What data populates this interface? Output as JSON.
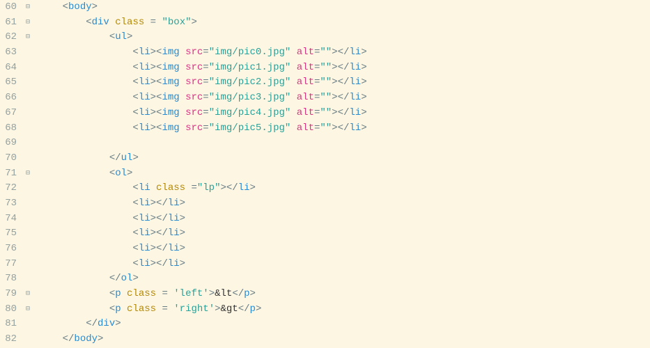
{
  "lines": [
    {
      "num": "60",
      "fold": "⊟",
      "indent": 1,
      "segments": [
        {
          "t": "punct",
          "v": "<"
        },
        {
          "t": "tag",
          "v": "body"
        },
        {
          "t": "punct",
          "v": ">"
        }
      ]
    },
    {
      "num": "61",
      "fold": "⊟",
      "indent": 2,
      "segments": [
        {
          "t": "punct",
          "v": "<"
        },
        {
          "t": "tag",
          "v": "div"
        },
        {
          "t": "text",
          "v": " "
        },
        {
          "t": "attr-name",
          "v": "class"
        },
        {
          "t": "text",
          "v": " "
        },
        {
          "t": "punct",
          "v": "="
        },
        {
          "t": "text",
          "v": " "
        },
        {
          "t": "string",
          "v": "\"box\""
        },
        {
          "t": "punct",
          "v": ">"
        }
      ]
    },
    {
      "num": "62",
      "fold": "⊟",
      "indent": 3,
      "segments": [
        {
          "t": "punct",
          "v": "<"
        },
        {
          "t": "tag",
          "v": "ul"
        },
        {
          "t": "punct",
          "v": ">"
        }
      ]
    },
    {
      "num": "63",
      "fold": "",
      "indent": 4,
      "segments": [
        {
          "t": "punct",
          "v": "<"
        },
        {
          "t": "tag",
          "v": "li"
        },
        {
          "t": "punct",
          "v": "><"
        },
        {
          "t": "tag",
          "v": "img"
        },
        {
          "t": "text",
          "v": " "
        },
        {
          "t": "attr-key",
          "v": "src"
        },
        {
          "t": "punct",
          "v": "="
        },
        {
          "t": "string",
          "v": "\"img/pic0.jpg\""
        },
        {
          "t": "text",
          "v": " "
        },
        {
          "t": "attr-key",
          "v": "alt"
        },
        {
          "t": "punct",
          "v": "="
        },
        {
          "t": "string",
          "v": "\"\""
        },
        {
          "t": "punct",
          "v": "></"
        },
        {
          "t": "tag",
          "v": "li"
        },
        {
          "t": "punct",
          "v": ">"
        }
      ]
    },
    {
      "num": "64",
      "fold": "",
      "indent": 4,
      "segments": [
        {
          "t": "punct",
          "v": "<"
        },
        {
          "t": "tag",
          "v": "li"
        },
        {
          "t": "punct",
          "v": "><"
        },
        {
          "t": "tag",
          "v": "img"
        },
        {
          "t": "text",
          "v": " "
        },
        {
          "t": "attr-key",
          "v": "src"
        },
        {
          "t": "punct",
          "v": "="
        },
        {
          "t": "string",
          "v": "\"img/pic1.jpg\""
        },
        {
          "t": "text",
          "v": " "
        },
        {
          "t": "attr-key",
          "v": "alt"
        },
        {
          "t": "punct",
          "v": "="
        },
        {
          "t": "string",
          "v": "\"\""
        },
        {
          "t": "punct",
          "v": "></"
        },
        {
          "t": "tag",
          "v": "li"
        },
        {
          "t": "punct",
          "v": ">"
        }
      ]
    },
    {
      "num": "65",
      "fold": "",
      "indent": 4,
      "segments": [
        {
          "t": "punct",
          "v": "<"
        },
        {
          "t": "tag",
          "v": "li"
        },
        {
          "t": "punct",
          "v": "><"
        },
        {
          "t": "tag",
          "v": "img"
        },
        {
          "t": "text",
          "v": " "
        },
        {
          "t": "attr-key",
          "v": "src"
        },
        {
          "t": "punct",
          "v": "="
        },
        {
          "t": "string",
          "v": "\"img/pic2.jpg\""
        },
        {
          "t": "text",
          "v": " "
        },
        {
          "t": "attr-key",
          "v": "alt"
        },
        {
          "t": "punct",
          "v": "="
        },
        {
          "t": "string",
          "v": "\"\""
        },
        {
          "t": "punct",
          "v": "></"
        },
        {
          "t": "tag",
          "v": "li"
        },
        {
          "t": "punct",
          "v": ">"
        }
      ]
    },
    {
      "num": "66",
      "fold": "",
      "indent": 4,
      "segments": [
        {
          "t": "punct",
          "v": "<"
        },
        {
          "t": "tag",
          "v": "li"
        },
        {
          "t": "punct",
          "v": "><"
        },
        {
          "t": "tag",
          "v": "img"
        },
        {
          "t": "text",
          "v": " "
        },
        {
          "t": "attr-key",
          "v": "src"
        },
        {
          "t": "punct",
          "v": "="
        },
        {
          "t": "string",
          "v": "\"img/pic3.jpg\""
        },
        {
          "t": "text",
          "v": " "
        },
        {
          "t": "attr-key",
          "v": "alt"
        },
        {
          "t": "punct",
          "v": "="
        },
        {
          "t": "string",
          "v": "\"\""
        },
        {
          "t": "punct",
          "v": "></"
        },
        {
          "t": "tag",
          "v": "li"
        },
        {
          "t": "punct",
          "v": ">"
        }
      ]
    },
    {
      "num": "67",
      "fold": "",
      "indent": 4,
      "segments": [
        {
          "t": "punct",
          "v": "<"
        },
        {
          "t": "tag",
          "v": "li"
        },
        {
          "t": "punct",
          "v": "><"
        },
        {
          "t": "tag",
          "v": "img"
        },
        {
          "t": "text",
          "v": " "
        },
        {
          "t": "attr-key",
          "v": "src"
        },
        {
          "t": "punct",
          "v": "="
        },
        {
          "t": "string",
          "v": "\"img/pic4.jpg\""
        },
        {
          "t": "text",
          "v": " "
        },
        {
          "t": "attr-key",
          "v": "alt"
        },
        {
          "t": "punct",
          "v": "="
        },
        {
          "t": "string",
          "v": "\"\""
        },
        {
          "t": "punct",
          "v": "></"
        },
        {
          "t": "tag",
          "v": "li"
        },
        {
          "t": "punct",
          "v": ">"
        }
      ]
    },
    {
      "num": "68",
      "fold": "",
      "indent": 4,
      "segments": [
        {
          "t": "punct",
          "v": "<"
        },
        {
          "t": "tag",
          "v": "li"
        },
        {
          "t": "punct",
          "v": "><"
        },
        {
          "t": "tag",
          "v": "img"
        },
        {
          "t": "text",
          "v": " "
        },
        {
          "t": "attr-key",
          "v": "src"
        },
        {
          "t": "punct",
          "v": "="
        },
        {
          "t": "string",
          "v": "\"img/pic5.jpg\""
        },
        {
          "t": "text",
          "v": " "
        },
        {
          "t": "attr-key",
          "v": "alt"
        },
        {
          "t": "punct",
          "v": "="
        },
        {
          "t": "string",
          "v": "\"\""
        },
        {
          "t": "punct",
          "v": "></"
        },
        {
          "t": "tag",
          "v": "li"
        },
        {
          "t": "punct",
          "v": ">"
        }
      ]
    },
    {
      "num": "69",
      "fold": "",
      "indent": 0,
      "segments": []
    },
    {
      "num": "70",
      "fold": "",
      "indent": 3,
      "segments": [
        {
          "t": "punct",
          "v": "</"
        },
        {
          "t": "tag",
          "v": "ul"
        },
        {
          "t": "punct",
          "v": ">"
        }
      ]
    },
    {
      "num": "71",
      "fold": "⊟",
      "indent": 3,
      "segments": [
        {
          "t": "punct",
          "v": "<"
        },
        {
          "t": "tag",
          "v": "ol"
        },
        {
          "t": "punct",
          "v": ">"
        }
      ]
    },
    {
      "num": "72",
      "fold": "",
      "indent": 4,
      "segments": [
        {
          "t": "punct",
          "v": "<"
        },
        {
          "t": "tag",
          "v": "li"
        },
        {
          "t": "text",
          "v": " "
        },
        {
          "t": "attr-name",
          "v": "class"
        },
        {
          "t": "text",
          "v": " "
        },
        {
          "t": "punct",
          "v": "="
        },
        {
          "t": "string",
          "v": "\"lp\""
        },
        {
          "t": "punct",
          "v": "></"
        },
        {
          "t": "tag",
          "v": "li"
        },
        {
          "t": "punct",
          "v": ">"
        }
      ]
    },
    {
      "num": "73",
      "fold": "",
      "indent": 4,
      "segments": [
        {
          "t": "punct",
          "v": "<"
        },
        {
          "t": "tag",
          "v": "li"
        },
        {
          "t": "punct",
          "v": "></"
        },
        {
          "t": "tag",
          "v": "li"
        },
        {
          "t": "punct",
          "v": ">"
        }
      ]
    },
    {
      "num": "74",
      "fold": "",
      "indent": 4,
      "segments": [
        {
          "t": "punct",
          "v": "<"
        },
        {
          "t": "tag",
          "v": "li"
        },
        {
          "t": "punct",
          "v": "></"
        },
        {
          "t": "tag",
          "v": "li"
        },
        {
          "t": "punct",
          "v": ">"
        }
      ]
    },
    {
      "num": "75",
      "fold": "",
      "indent": 4,
      "segments": [
        {
          "t": "punct",
          "v": "<"
        },
        {
          "t": "tag",
          "v": "li"
        },
        {
          "t": "punct",
          "v": "></"
        },
        {
          "t": "tag",
          "v": "li"
        },
        {
          "t": "punct",
          "v": ">"
        }
      ]
    },
    {
      "num": "76",
      "fold": "",
      "indent": 4,
      "segments": [
        {
          "t": "punct",
          "v": "<"
        },
        {
          "t": "tag",
          "v": "li"
        },
        {
          "t": "punct",
          "v": "></"
        },
        {
          "t": "tag",
          "v": "li"
        },
        {
          "t": "punct",
          "v": ">"
        }
      ]
    },
    {
      "num": "77",
      "fold": "",
      "indent": 4,
      "segments": [
        {
          "t": "punct",
          "v": "<"
        },
        {
          "t": "tag",
          "v": "li"
        },
        {
          "t": "punct",
          "v": "></"
        },
        {
          "t": "tag",
          "v": "li"
        },
        {
          "t": "punct",
          "v": ">"
        }
      ]
    },
    {
      "num": "78",
      "fold": "",
      "indent": 3,
      "segments": [
        {
          "t": "punct",
          "v": "</"
        },
        {
          "t": "tag",
          "v": "ol"
        },
        {
          "t": "punct",
          "v": ">"
        }
      ]
    },
    {
      "num": "79",
      "fold": "⊟",
      "indent": 3,
      "segments": [
        {
          "t": "punct",
          "v": "<"
        },
        {
          "t": "tag",
          "v": "p"
        },
        {
          "t": "text",
          "v": " "
        },
        {
          "t": "attr-name",
          "v": "class"
        },
        {
          "t": "text",
          "v": " "
        },
        {
          "t": "punct",
          "v": "="
        },
        {
          "t": "text",
          "v": " "
        },
        {
          "t": "string",
          "v": "'left'"
        },
        {
          "t": "punct",
          "v": ">"
        },
        {
          "t": "text",
          "v": "&lt"
        },
        {
          "t": "punct",
          "v": "</"
        },
        {
          "t": "tag",
          "v": "p"
        },
        {
          "t": "punct",
          "v": ">"
        }
      ]
    },
    {
      "num": "80",
      "fold": "⊟",
      "indent": 3,
      "segments": [
        {
          "t": "punct",
          "v": "<"
        },
        {
          "t": "tag",
          "v": "p"
        },
        {
          "t": "text",
          "v": " "
        },
        {
          "t": "attr-name",
          "v": "class"
        },
        {
          "t": "text",
          "v": " "
        },
        {
          "t": "punct",
          "v": "="
        },
        {
          "t": "text",
          "v": " "
        },
        {
          "t": "string",
          "v": "'right'"
        },
        {
          "t": "punct",
          "v": ">"
        },
        {
          "t": "text",
          "v": "&gt"
        },
        {
          "t": "punct",
          "v": "</"
        },
        {
          "t": "tag",
          "v": "p"
        },
        {
          "t": "punct",
          "v": ">"
        }
      ]
    },
    {
      "num": "81",
      "fold": "",
      "indent": 2,
      "segments": [
        {
          "t": "punct",
          "v": "</"
        },
        {
          "t": "tag",
          "v": "div"
        },
        {
          "t": "punct",
          "v": ">"
        }
      ]
    },
    {
      "num": "82",
      "fold": "",
      "indent": 1,
      "segments": [
        {
          "t": "punct",
          "v": "</"
        },
        {
          "t": "tag",
          "v": "body"
        },
        {
          "t": "punct",
          "v": ">"
        }
      ]
    }
  ],
  "indent_unit": "    "
}
